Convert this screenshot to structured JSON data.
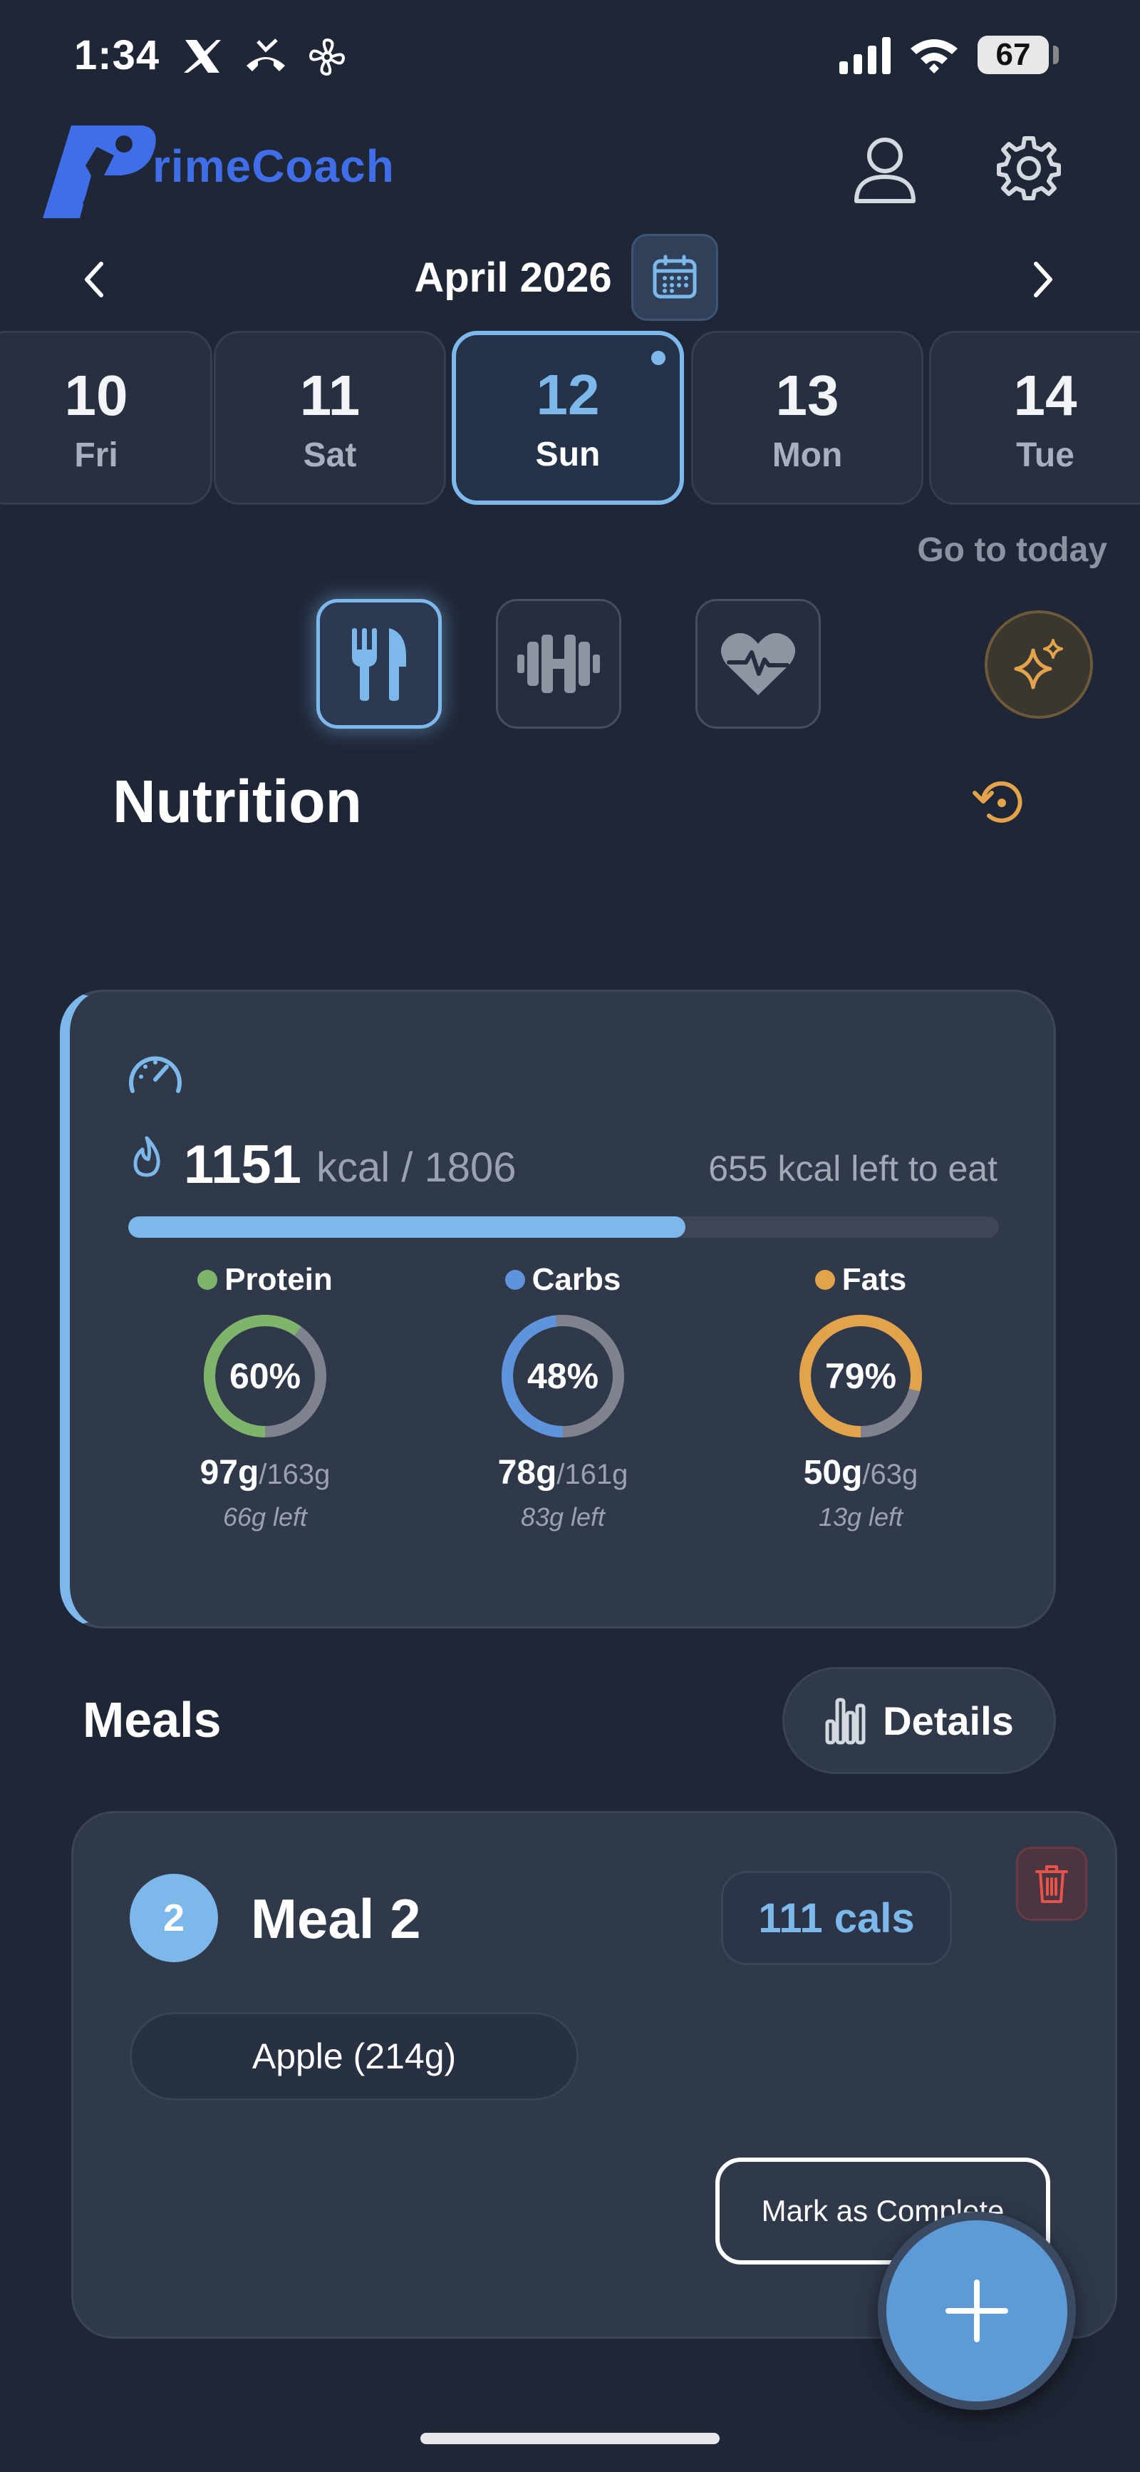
{
  "status_bar": {
    "time": "1:34",
    "battery": "67",
    "icons": [
      "x-logo-icon",
      "missed-call-icon",
      "fan-icon",
      "signal-icon",
      "wifi-icon",
      "battery-icon"
    ]
  },
  "header": {
    "brand_rest": "rimeCoach",
    "brand_color": "#3f6ee8",
    "profile_icon": "person-icon",
    "settings_icon": "gear-icon"
  },
  "calendar": {
    "month": "April 2026",
    "days": [
      {
        "num": "10",
        "weekday": "Fri"
      },
      {
        "num": "11",
        "weekday": "Sat"
      },
      {
        "num": "12",
        "weekday": "Sun"
      },
      {
        "num": "13",
        "weekday": "Mon"
      },
      {
        "num": "14",
        "weekday": "Tue"
      }
    ],
    "selected_index": 2,
    "go_to_today": "Go to today",
    "accent": "#7db8ea"
  },
  "modes": [
    {
      "icon": "fork-knife-icon",
      "active": true
    },
    {
      "icon": "dumbbell-icon",
      "active": false
    },
    {
      "icon": "heart-pulse-icon",
      "active": false
    }
  ],
  "section_title": "Nutrition",
  "summary": {
    "kcal_eaten": "1151",
    "kcal_goal_text": "kcal / 1806",
    "kcal_left_text": "655 kcal left to eat",
    "progress": 0.64,
    "macros": [
      {
        "name": "Protein",
        "percent_label": "60%",
        "percent": 0.6,
        "amount": "97g",
        "goal": "/163g",
        "left": "66g left",
        "color": "#7fb56a"
      },
      {
        "name": "Carbs",
        "percent_label": "48%",
        "percent": 0.48,
        "amount": "78g",
        "goal": "/161g",
        "left": "83g left",
        "color": "#5e93de"
      },
      {
        "name": "Fats",
        "percent_label": "79%",
        "percent": 0.79,
        "amount": "50g",
        "goal": "/63g",
        "left": "13g left",
        "color": "#e3a34b"
      }
    ]
  },
  "meals": {
    "title": "Meals",
    "details_label": "Details",
    "items": [
      {
        "number": "2",
        "title": "Meal 2",
        "cals": "111 cals",
        "foods": [
          "Apple (214g)"
        ],
        "complete_label": "Mark as Complete"
      }
    ]
  }
}
